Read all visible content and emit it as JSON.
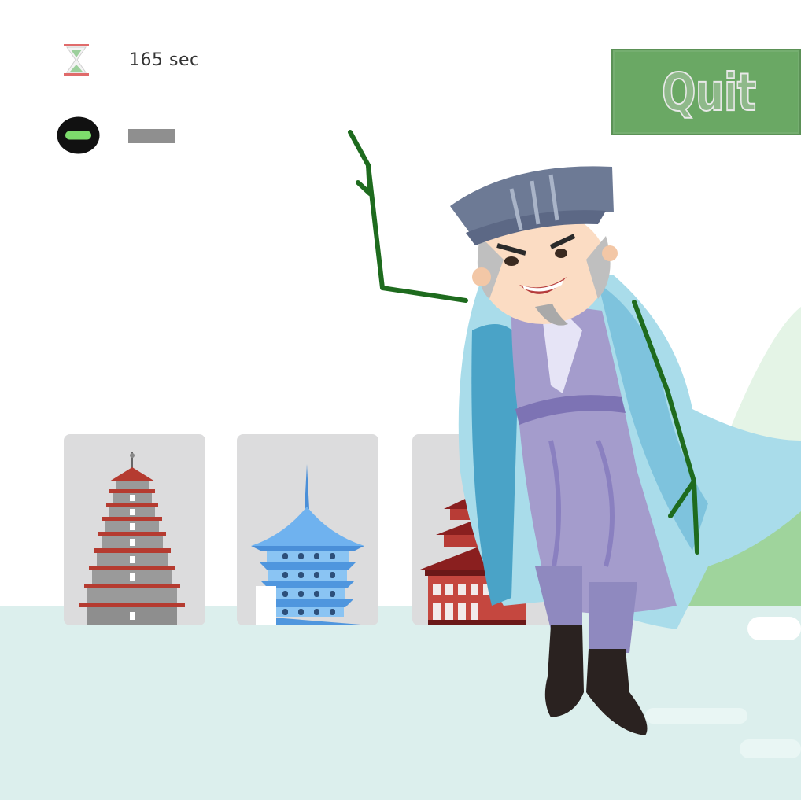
{
  "hud": {
    "timer_icon": "hourglass-icon",
    "timer_text": "165 sec",
    "lives_icon": "minus-circle-icon"
  },
  "quit_button": {
    "label": "Quit",
    "color": "#6aa864"
  },
  "cards": [
    {
      "name": "red-tiered-pagoda-card",
      "icon": "red-pagoda-icon"
    },
    {
      "name": "blue-pagoda-card",
      "icon": "blue-pagoda-icon"
    },
    {
      "name": "red-temple-card",
      "icon": "red-temple-icon"
    }
  ],
  "character": {
    "icon": "scholar-character-icon",
    "stroke_color": "#1e6b1e"
  },
  "colors": {
    "ground": "#dcefed",
    "card_background": "#dcdcdd",
    "accent_green": "#6aa864"
  }
}
